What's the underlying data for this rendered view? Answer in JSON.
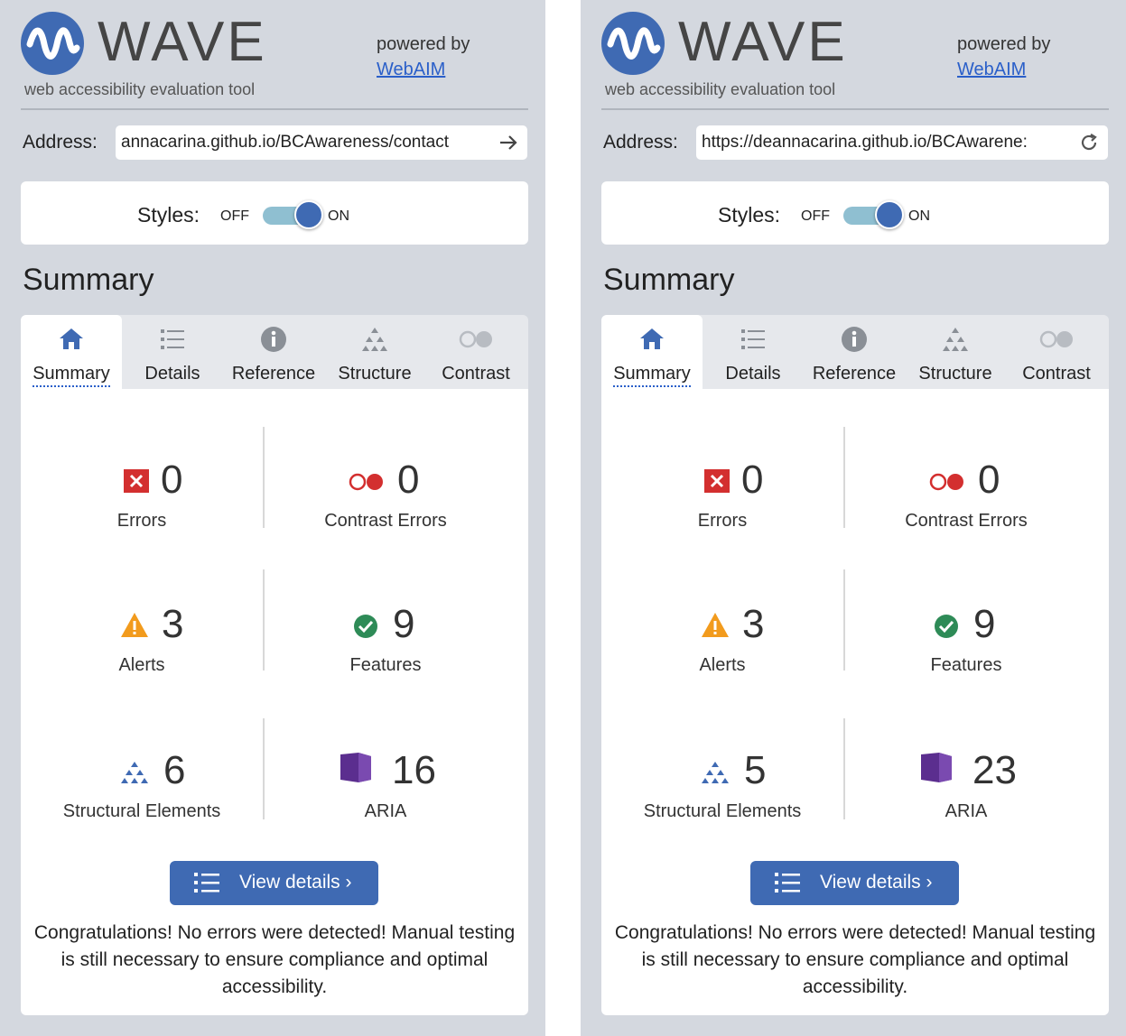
{
  "panels": [
    {
      "logo": {
        "title": "WAVE",
        "subtitle": "web accessibility evaluation tool"
      },
      "powered_by": {
        "text": "powered by",
        "link": "WebAIM"
      },
      "address": {
        "label": "Address:",
        "value": "annacarina.github.io/BCAwareness/contact",
        "action_icon": "arrow-right-icon"
      },
      "styles": {
        "label": "Styles:",
        "off": "OFF",
        "on": "ON",
        "state": "on"
      },
      "heading": "Summary",
      "tabs": [
        {
          "label": "Summary",
          "icon": "home-icon",
          "active": true
        },
        {
          "label": "Details",
          "icon": "list-icon"
        },
        {
          "label": "Reference",
          "icon": "info-icon"
        },
        {
          "label": "Structure",
          "icon": "structure-icon"
        },
        {
          "label": "Contrast",
          "icon": "contrast-icon"
        }
      ],
      "stats": {
        "errors": {
          "value": "0",
          "label": "Errors"
        },
        "contrast_errors": {
          "value": "0",
          "label": "Contrast Errors"
        },
        "alerts": {
          "value": "3",
          "label": "Alerts"
        },
        "features": {
          "value": "9",
          "label": "Features"
        },
        "structural": {
          "value": "6",
          "label": "Structural Elements"
        },
        "aria": {
          "value": "16",
          "label": "ARIA"
        }
      },
      "view_details": "View details ›",
      "message": "Congratulations! No errors were detected! Manual testing is still necessary to ensure compliance and optimal accessibility."
    },
    {
      "logo": {
        "title": "WAVE",
        "subtitle": "web accessibility evaluation tool"
      },
      "powered_by": {
        "text": "powered by",
        "link": "WebAIM"
      },
      "address": {
        "label": "Address:",
        "value": "https://deannacarina.github.io/BCAwarene:",
        "action_icon": "refresh-icon"
      },
      "styles": {
        "label": "Styles:",
        "off": "OFF",
        "on": "ON",
        "state": "on"
      },
      "heading": "Summary",
      "tabs": [
        {
          "label": "Summary",
          "icon": "home-icon",
          "active": true
        },
        {
          "label": "Details",
          "icon": "list-icon"
        },
        {
          "label": "Reference",
          "icon": "info-icon"
        },
        {
          "label": "Structure",
          "icon": "structure-icon"
        },
        {
          "label": "Contrast",
          "icon": "contrast-icon"
        }
      ],
      "stats": {
        "errors": {
          "value": "0",
          "label": "Errors"
        },
        "contrast_errors": {
          "value": "0",
          "label": "Contrast Errors"
        },
        "alerts": {
          "value": "3",
          "label": "Alerts"
        },
        "features": {
          "value": "9",
          "label": "Features"
        },
        "structural": {
          "value": "5",
          "label": "Structural Elements"
        },
        "aria": {
          "value": "23",
          "label": "ARIA"
        }
      },
      "view_details": "View details ›",
      "message": "Congratulations! No errors were detected! Manual testing is still necessary to ensure compliance and optimal accessibility."
    }
  ],
  "colors": {
    "panel_bg": "#d4d8df",
    "brand_blue": "#3f6ab3",
    "link_blue": "#2a5fc9",
    "error_red": "#d32f2f",
    "alert_orange": "#f29b1d",
    "feature_green": "#2e8b57",
    "aria_purple": "#5b2e8f"
  }
}
